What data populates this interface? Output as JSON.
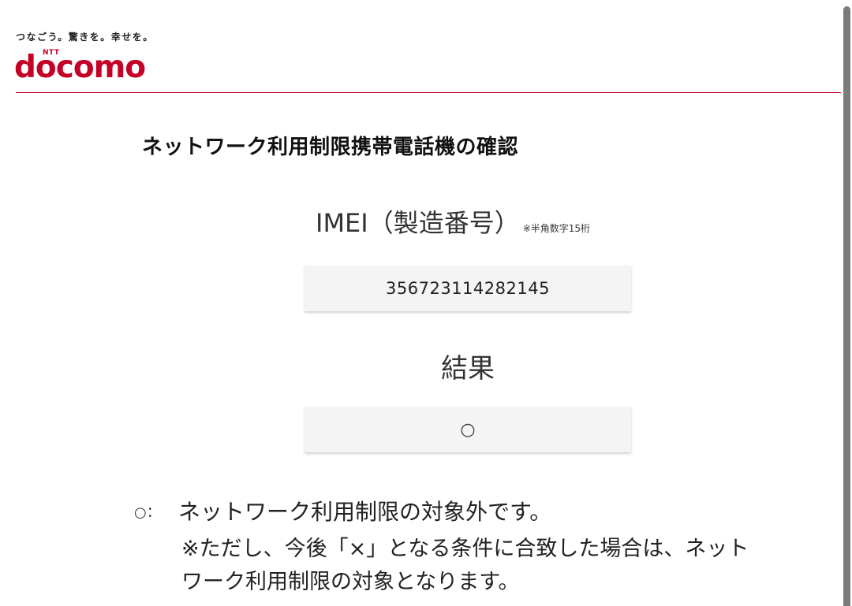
{
  "header": {
    "tagline": "つなごう。驚きを。幸せを。",
    "logo_ntt": "NTT",
    "logo_text": "docomo",
    "brand_color": "#c40026"
  },
  "page_title": "ネットワーク利用制限携帯電話機の確認",
  "imei": {
    "label": "IMEI（製造番号）",
    "note": "※半角数字15桁",
    "value": "356723114282145"
  },
  "result": {
    "label": "結果",
    "value": "○"
  },
  "legend": {
    "symbol": "○：",
    "main_text": "ネットワーク利用制限の対象外です。",
    "note_line1": "※ただし、今後「×」となる条件に合致した場合は、ネット",
    "note_line2": "ワーク利用制限の対象となります。"
  }
}
